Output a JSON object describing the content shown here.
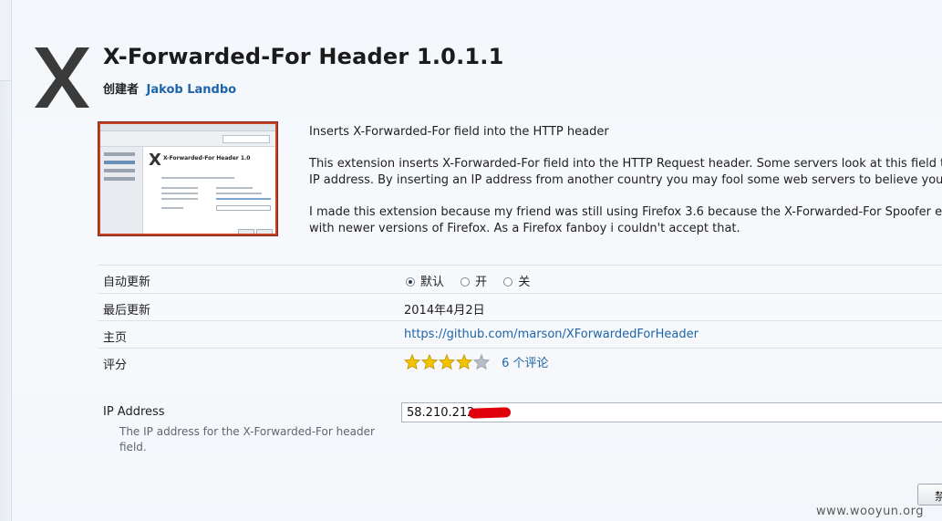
{
  "header": {
    "icon_name": "x-logo-icon",
    "title": "X-Forwarded-For Header 1.0.1.1",
    "creator_label": "创建者",
    "creator_name": "Jakob Landbo"
  },
  "screenshot_thumbnail": {
    "title": "X-Forwarded-For Header 1.0",
    "border_color": "#c8411f"
  },
  "description": {
    "summary": "Inserts X-Forwarded-For field into the HTTP header",
    "para1_line1": "This extension inserts X-Forwarded-For field into the HTTP Request header. Some servers look at this field to i",
    "para1_line2": "IP address. By inserting an IP address from another country you may fool some web servers to believe you are",
    "para2_line1": "I made this extension because my friend was still using Firefox 3.6 because the X-Forwarded-For Spoofer exter",
    "para2_line2": "with newer versions of Firefox. As a Firefox fanboy i couldn't accept that."
  },
  "details": {
    "auto_update": {
      "label": "自动更新",
      "options": [
        "默认",
        "开",
        "关"
      ],
      "selected": "默认"
    },
    "last_updated": {
      "label": "最后更新",
      "value": "2014年4月2日"
    },
    "homepage": {
      "label": "主页",
      "value": "https://github.com/marson/XForwardedForHeader"
    },
    "rating": {
      "label": "评分",
      "stars": 4,
      "max_stars": 5,
      "reviews": "6 个评论"
    }
  },
  "ip_setting": {
    "label": "IP Address",
    "description": "The IP address for the X-Forwarded-For header field.",
    "value": "58.210.212."
  },
  "corner_button_label": "禁",
  "watermark": "www.wooyun.org",
  "colors": {
    "link": "#1e64a8",
    "star_fill": "#f5c400",
    "star_empty": "#b7bec7",
    "redaction": "#e0000b"
  }
}
